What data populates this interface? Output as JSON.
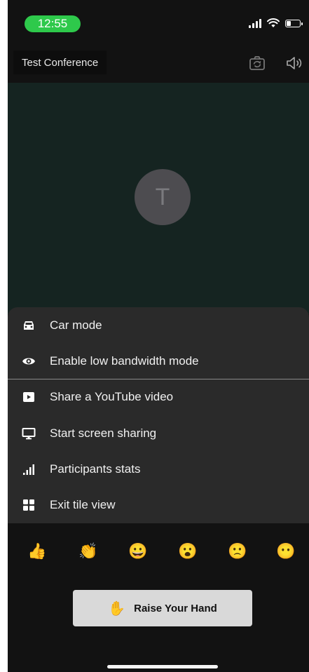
{
  "status_bar": {
    "time": "12:55",
    "accent_color": "#2ec94b",
    "icons": [
      "cellular-signal-icon",
      "wifi-icon",
      "battery-icon"
    ],
    "battery_level": 0.35
  },
  "toolbar": {
    "conference_title": "Test Conference",
    "icons": [
      "camera-switch-icon",
      "speaker-icon"
    ]
  },
  "participant": {
    "avatar_initial": "T"
  },
  "menu": {
    "items": [
      {
        "label": "Car mode",
        "icon": "car-icon"
      },
      {
        "label": "Enable low bandwidth mode",
        "icon": "eye-icon"
      },
      {
        "label": "Share a YouTube video",
        "icon": "youtube-play-icon"
      },
      {
        "label": "Start screen sharing",
        "icon": "monitor-icon"
      },
      {
        "label": "Participants stats",
        "icon": "stats-bars-icon"
      },
      {
        "label": "Exit tile view",
        "icon": "tile-grid-icon"
      }
    ]
  },
  "reactions": [
    {
      "emoji": "👍",
      "icon": "thumbs-up-icon"
    },
    {
      "emoji": "👏",
      "icon": "clapping-hands-icon"
    },
    {
      "emoji": "😀",
      "icon": "grinning-face-icon"
    },
    {
      "emoji": "😮",
      "icon": "surprised-face-icon"
    },
    {
      "emoji": "🙁",
      "icon": "sad-face-icon"
    },
    {
      "emoji": "😶",
      "icon": "silent-face-icon"
    }
  ],
  "raise_hand": {
    "emoji": "✋",
    "label": "Raise Your Hand"
  }
}
